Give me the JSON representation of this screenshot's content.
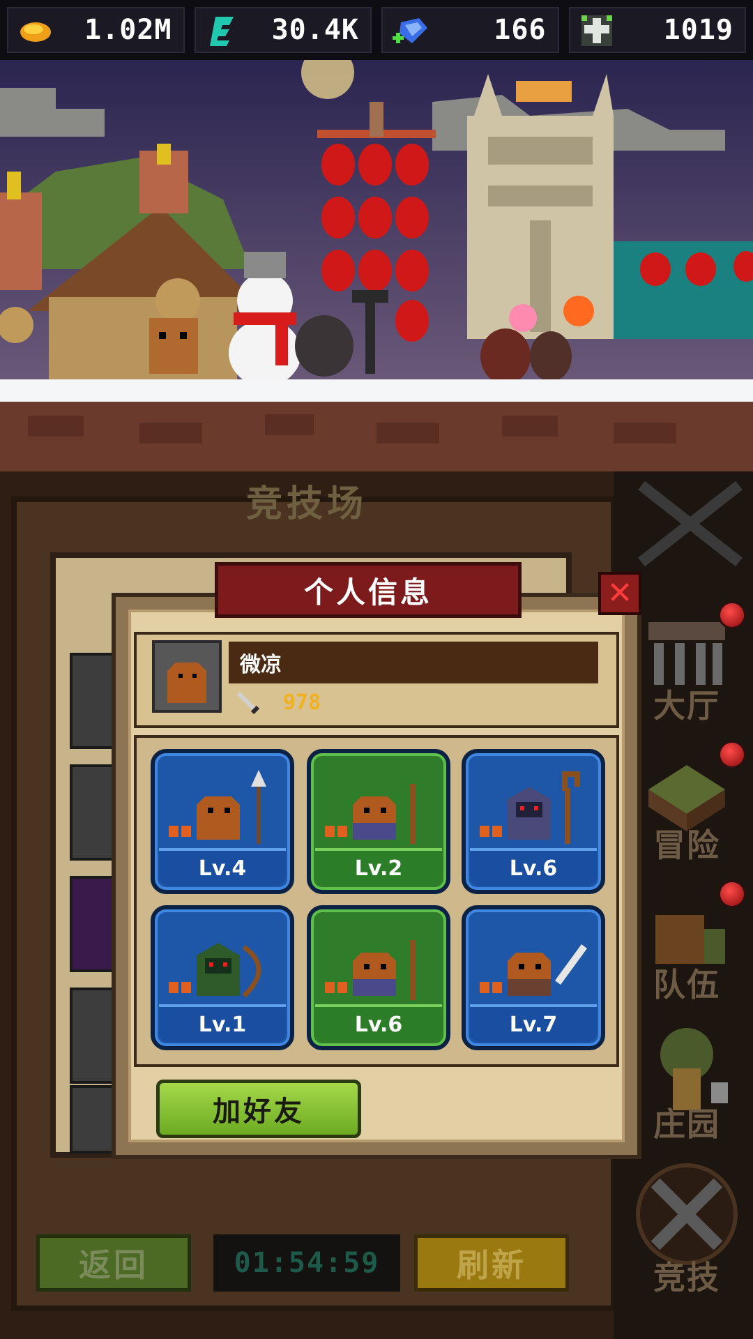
{
  "resources": [
    {
      "icon": "gold-icon",
      "value": "1.02M"
    },
    {
      "icon": "energy-icon",
      "value": "30.4K"
    },
    {
      "icon": "gem-icon",
      "value": "166"
    },
    {
      "icon": "cross-icon",
      "value": "1019"
    }
  ],
  "arena": {
    "title": "竞技场",
    "back_label": "返回",
    "timer": "01:54:59",
    "refresh_label": "刷新"
  },
  "side_nav": [
    {
      "label": "大厅"
    },
    {
      "label": "冒险"
    },
    {
      "label": "队伍"
    },
    {
      "label": "庄园"
    },
    {
      "label": "竞技"
    }
  ],
  "popup": {
    "title": "个人信息",
    "close_symbol": "✕",
    "player": {
      "name": "微凉",
      "power": "978"
    },
    "heroes": [
      {
        "level": "Lv.4",
        "color": "blue",
        "weapon": "spear"
      },
      {
        "level": "Lv.2",
        "color": "green",
        "weapon": "staff"
      },
      {
        "level": "Lv.6",
        "color": "blue",
        "weapon": "crook"
      },
      {
        "level": "Lv.1",
        "color": "blue",
        "weapon": "bow"
      },
      {
        "level": "Lv.6",
        "color": "green",
        "weapon": "staff"
      },
      {
        "level": "Lv.7",
        "color": "blue",
        "weapon": "sword"
      }
    ],
    "add_friend_label": "加好友"
  }
}
